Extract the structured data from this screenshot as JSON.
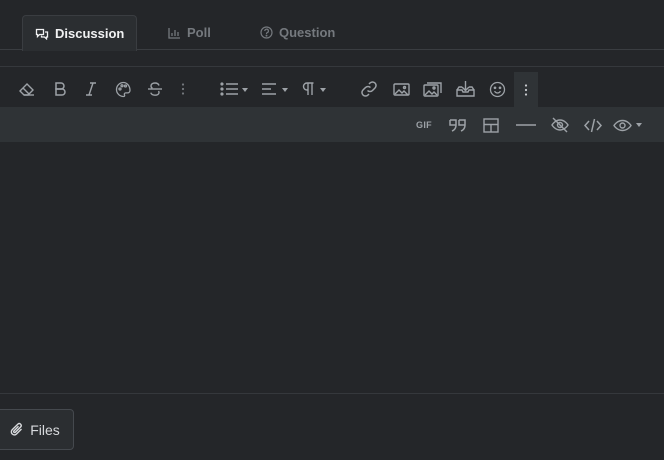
{
  "tabs": [
    {
      "label": "Discussion",
      "icon": "comments-icon",
      "active": true
    },
    {
      "label": "Poll",
      "icon": "bar-chart-icon",
      "active": false
    },
    {
      "label": "Question",
      "icon": "question-circle-icon",
      "active": false
    }
  ],
  "toolbar": {
    "row1": [
      "eraser-icon",
      "bold-icon",
      "italic-icon",
      "palette-icon",
      "strikethrough-icon",
      "more-vertical-icon",
      "list-icon",
      "align-left-icon",
      "paragraph-icon",
      "link-icon",
      "image-icon",
      "media-icon",
      "insert-icon",
      "smile-icon",
      "more-vertical-icon"
    ],
    "row2": [
      "gif-icon",
      "quote-icon",
      "table-icon",
      "horizontal-rule-icon",
      "hide-icon",
      "code-icon",
      "preview-icon"
    ],
    "gif_label": "GIF"
  },
  "footer": {
    "files_label": "Files"
  },
  "colors": {
    "background": "#242629",
    "toolbar_bg": "#2f3336",
    "active_tab_bg": "#2b2e31",
    "icon": "#9da2a7"
  }
}
